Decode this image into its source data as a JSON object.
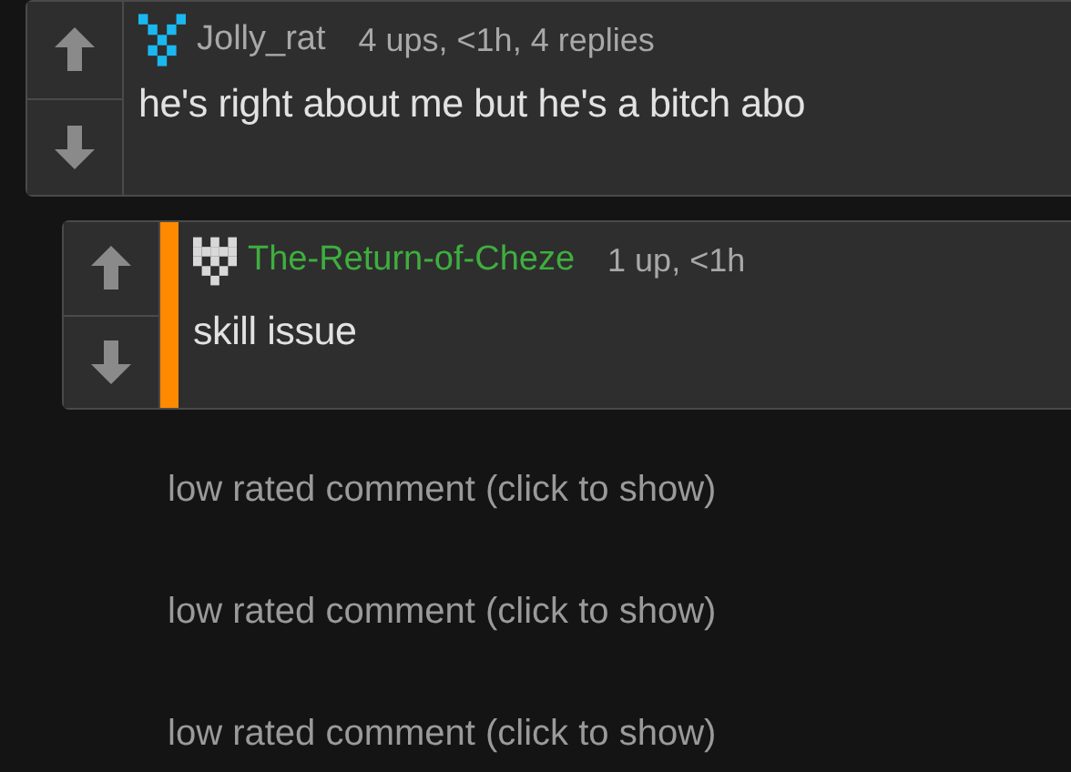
{
  "comments": [
    {
      "kind": "comment",
      "avatar": {
        "kind": "cross"
      },
      "user": "Jolly_rat",
      "color": "#a8a8a8",
      "meta": "4 ups, <1h, 4 replies",
      "highlighted": false,
      "text": "he's right about me but he's a bitch abo",
      "children": [
        {
          "kind": "comment",
          "avatar": {
            "kind": "crown"
          },
          "user": "The-Return-of-Cheze",
          "color": "#3fae3f",
          "meta": "1 up, <1h",
          "highlighted": true,
          "text": "skill issue"
        },
        {
          "kind": "collapsed",
          "text": "low rated comment (click to show)"
        },
        {
          "kind": "collapsed",
          "text": "low rated comment (click to show)"
        },
        {
          "kind": "collapsed",
          "text": "low rated comment (click to show)"
        }
      ]
    }
  ]
}
